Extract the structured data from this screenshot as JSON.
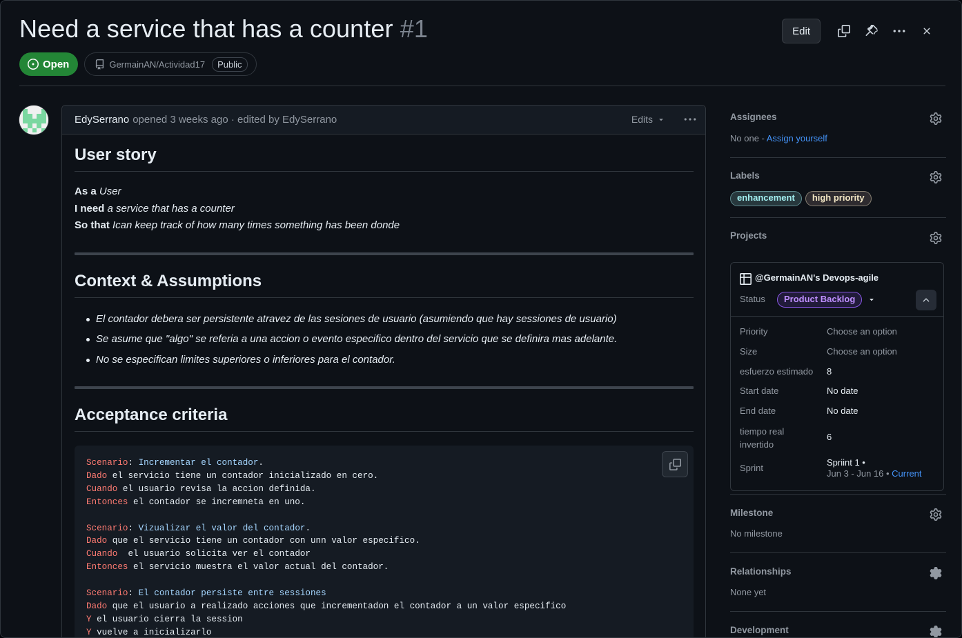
{
  "issue": {
    "title": "Need a service that has a counter",
    "number": "#1",
    "state": "Open",
    "repo": "GermainAN/Actividad17",
    "visibility": "Public"
  },
  "header": {
    "edit_label": "Edit"
  },
  "comment": {
    "author": "EdySerrano",
    "meta": "opened 3 weeks ago · edited by EdySerrano",
    "edits_label": "Edits",
    "user_story": {
      "heading": "User story",
      "lines": [
        {
          "prefix": "As a",
          "text": "User"
        },
        {
          "prefix": "I need",
          "text": "a service that has a counter"
        },
        {
          "prefix": "So that",
          "text": "Ican keep track of how many times something has been donde"
        }
      ]
    },
    "context": {
      "heading": "Context & Assumptions",
      "items": [
        "El contador debera ser persistente atravez de las sesiones de usuario (asumiendo que hay sessiones de usuario)",
        "Se asume que \"algo\" se referia a una accion o evento especifico dentro del servicio que se definira mas adelante.",
        "No se especifican limites superiores o inferiores para el contador."
      ]
    },
    "acceptance": {
      "heading": "Acceptance criteria",
      "code": [
        [
          {
            "c": "kw",
            "t": "Scenario"
          },
          {
            "c": "",
            "t": ": "
          },
          {
            "c": "ttl",
            "t": "Incrementar el contador"
          },
          {
            "c": "",
            "t": "."
          }
        ],
        [
          {
            "c": "kw",
            "t": "Dado"
          },
          {
            "c": "",
            "t": " el servicio tiene un contador inicializado en cero."
          }
        ],
        [
          {
            "c": "kw",
            "t": "Cuando"
          },
          {
            "c": "",
            "t": " el usuario revisa la accion definida."
          }
        ],
        [
          {
            "c": "kw",
            "t": "Entonces"
          },
          {
            "c": "",
            "t": " el contador se incremneta en uno."
          }
        ],
        [],
        [
          {
            "c": "kw",
            "t": "Scenario"
          },
          {
            "c": "",
            "t": ": "
          },
          {
            "c": "ttl",
            "t": "Vizualizar el valor del contador"
          },
          {
            "c": "",
            "t": "."
          }
        ],
        [
          {
            "c": "kw",
            "t": "Dado"
          },
          {
            "c": "",
            "t": " que el servicio tiene un contador con unn valor especifico."
          }
        ],
        [
          {
            "c": "kw",
            "t": "Cuando"
          },
          {
            "c": "",
            "t": "  el usuario solicita ver el contador"
          }
        ],
        [
          {
            "c": "kw",
            "t": "Entonces"
          },
          {
            "c": "",
            "t": " el servicio muestra el valor actual del contador."
          }
        ],
        [],
        [
          {
            "c": "kw",
            "t": "Scenario"
          },
          {
            "c": "",
            "t": ": "
          },
          {
            "c": "ttl",
            "t": "El contador persiste entre sessiones"
          }
        ],
        [
          {
            "c": "kw",
            "t": "Dado"
          },
          {
            "c": "",
            "t": " que el usuario a realizado acciones que incrementadon el contador a un valor especifico"
          }
        ],
        [
          {
            "c": "kw",
            "t": "Y"
          },
          {
            "c": "",
            "t": " el usuario cierra la session"
          }
        ],
        [
          {
            "c": "kw",
            "t": "Y"
          },
          {
            "c": "",
            "t": " vuelve a inicializarlo"
          }
        ]
      ]
    }
  },
  "sidebar": {
    "assignees": {
      "title": "Assignees",
      "none": "No one - ",
      "assign_link": "Assign yourself"
    },
    "labels": {
      "title": "Labels",
      "items": [
        {
          "name": "enhancement",
          "bg": "#a2eeef",
          "fg": "#a2eeef"
        },
        {
          "name": "high priority",
          "bg": "#f9d0c4",
          "fg": "#f2e6c4"
        }
      ]
    },
    "projects": {
      "title": "Projects",
      "name": "@GermainAN's Devops-agile",
      "status_label": "Status",
      "status_value": "Product Backlog",
      "fields": [
        {
          "label": "Priority",
          "value": "Choose an option",
          "muted": true
        },
        {
          "label": "Size",
          "value": "Choose an option",
          "muted": true
        },
        {
          "label": "esfuerzo estimado",
          "value": "8",
          "muted": false
        },
        {
          "label": "Start date",
          "value": "No date",
          "muted": false
        },
        {
          "label": "End date",
          "value": "No date",
          "muted": false
        },
        {
          "label": "tiempo real invertido",
          "value": "6",
          "muted": false
        }
      ],
      "sprint": {
        "label": "Sprint",
        "name": "Spriint 1 •",
        "range": "Jun 3 - Jun 16 • ",
        "current": "Current"
      }
    },
    "milestone": {
      "title": "Milestone",
      "value": "No milestone"
    },
    "relationships": {
      "title": "Relationships",
      "value": "None yet"
    },
    "development": {
      "title": "Development"
    }
  },
  "colors": {
    "accent": "#4493f8",
    "open": "#238636",
    "status_purple": "#8957e5"
  }
}
